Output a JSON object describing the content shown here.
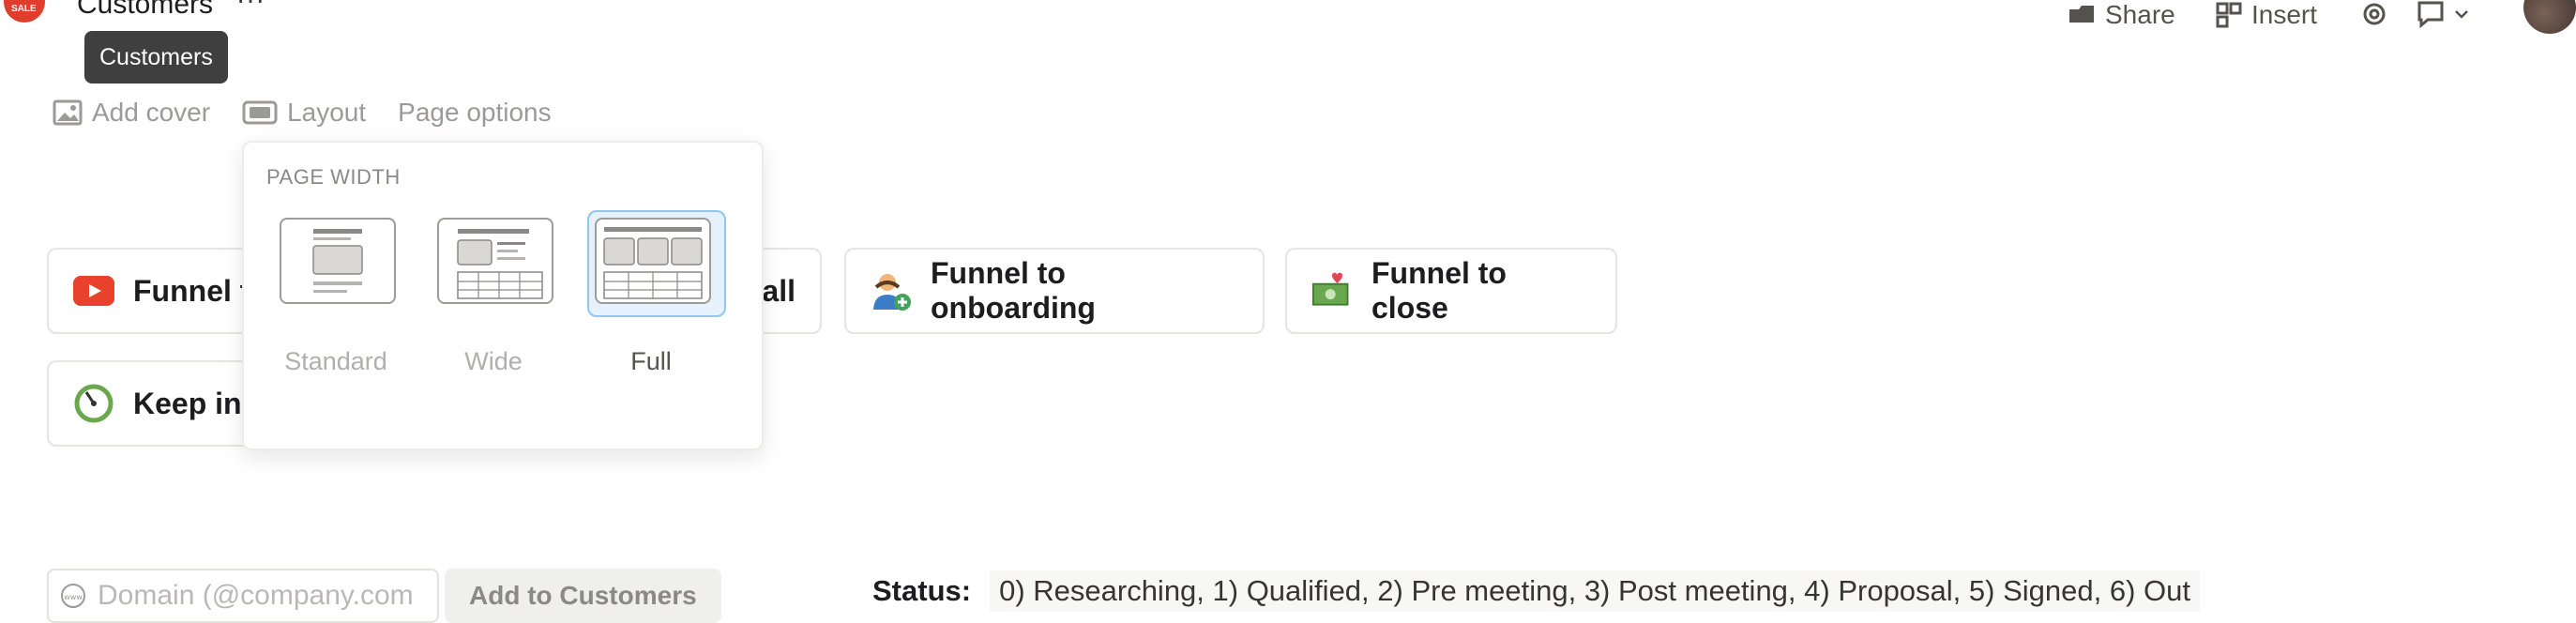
{
  "header": {
    "title": "Customers",
    "more": "···",
    "share_label": "Share",
    "insert_label": "Insert"
  },
  "tooltip": {
    "text": "Customers"
  },
  "page_controls": {
    "add_cover": "Add cover",
    "layout": "Layout",
    "page_options": "Page options"
  },
  "layout_popover": {
    "heading": "PAGE WIDTH",
    "options": [
      {
        "label": "Standard",
        "selected": false
      },
      {
        "label": "Wide",
        "selected": false
      },
      {
        "label": "Full",
        "selected": true
      }
    ]
  },
  "cards": [
    {
      "label": "Funnel t",
      "icon": "youtube-icon"
    },
    {
      "label": "all",
      "icon": ""
    },
    {
      "label": "Funnel to onboarding",
      "icon": "person-add-icon"
    },
    {
      "label": "Funnel to close",
      "icon": "money-heart-icon"
    },
    {
      "label": "Keep in",
      "icon": "stopwatch-icon"
    }
  ],
  "domain_form": {
    "placeholder": "Domain (@company.com",
    "button_label": "Add to Customers"
  },
  "status": {
    "label": "Status:",
    "values": "0) Researching, 1) Qualified, 2) Pre meeting, 3) Post meeting, 4) Proposal, 5) Signed, 6) Out"
  },
  "colors": {
    "accent_blue": "#8ec7ef",
    "logo_red": "#e03e2d",
    "youtube_red": "#e8412c"
  }
}
